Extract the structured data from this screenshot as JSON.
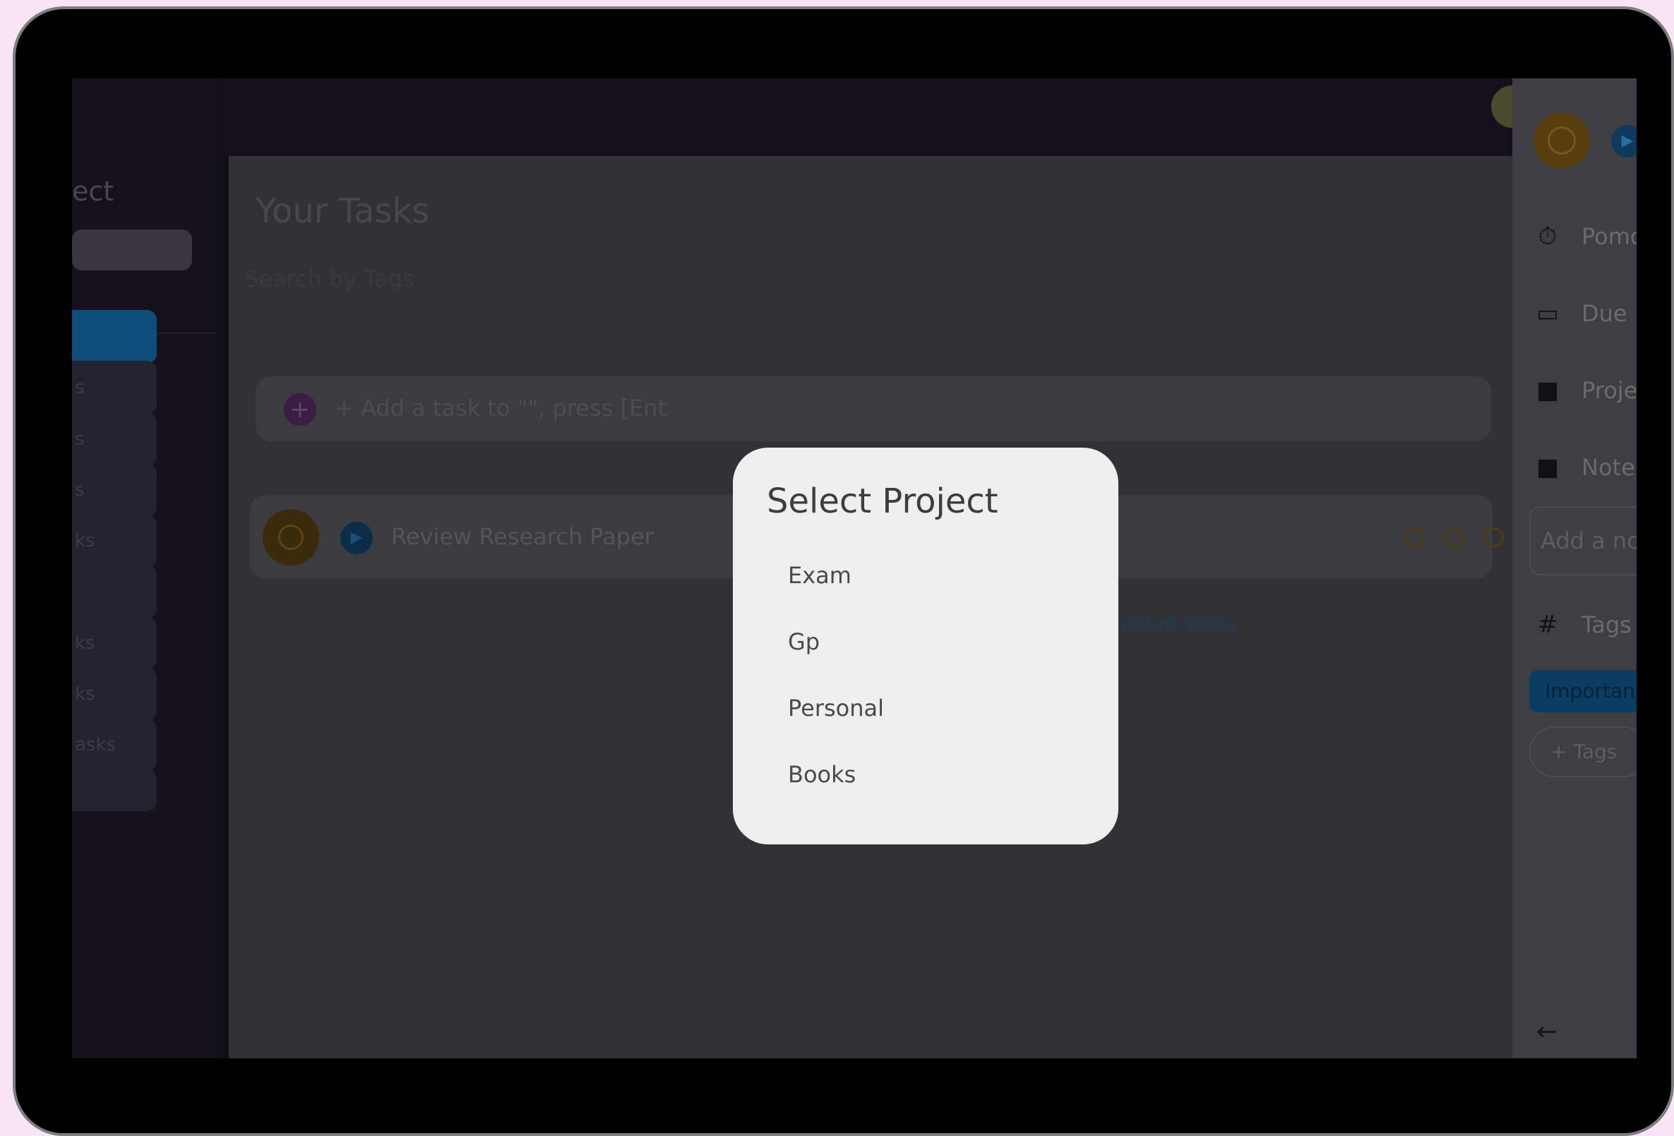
{
  "sidebar": {
    "title": "ect",
    "items": [
      {
        "label": ""
      },
      {
        "label": "s"
      },
      {
        "label": "s"
      },
      {
        "label": "s"
      },
      {
        "label": "ks"
      },
      {
        "label": ""
      },
      {
        "label": "ks"
      },
      {
        "label": "ks"
      },
      {
        "label": "asks"
      }
    ]
  },
  "main": {
    "title": "Your Tasks",
    "search_label": "Search by Tags",
    "add_task_icon": "+",
    "add_task_placeholder": "+ Add a task to \"\", press [Ent",
    "task": {
      "name": "Review Research Paper",
      "play_glyph": "▶"
    },
    "completed_link": "pleted Tasks"
  },
  "modal": {
    "title": "Select Project",
    "options": [
      "Exam",
      "Gp",
      "Personal",
      "Books"
    ]
  },
  "right_panel": {
    "play_glyph": "▶",
    "rows": {
      "pomodoro": {
        "icon": "⏱",
        "label": "Pomo"
      },
      "due_date": {
        "icon": "▭",
        "label": "Due D"
      },
      "project": {
        "icon": "■",
        "label": "Proje"
      },
      "notes": {
        "icon": "■",
        "label": "Notes"
      },
      "tags": {
        "icon": "#",
        "label": "Tags"
      }
    },
    "note_placeholder": "Add a no",
    "tag_chip": "Importan",
    "add_tags": "+ Tags",
    "back_glyph": "←"
  },
  "colors": {
    "modal_bg": "#efefef",
    "accent_orange": "#e59a16",
    "accent_blue": "#1e88e5",
    "backdrop": "#323135"
  }
}
